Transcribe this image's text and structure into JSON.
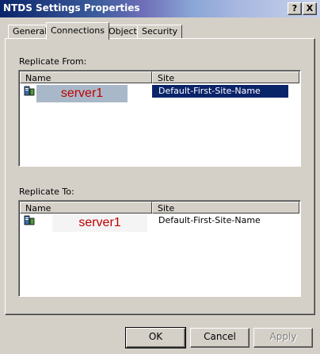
{
  "window": {
    "title": "NTDS Settings Properties"
  },
  "titlebar_buttons": {
    "help": "?",
    "close": "X"
  },
  "tabs": [
    {
      "label": "General",
      "active": false
    },
    {
      "label": "Connections",
      "active": true
    },
    {
      "label": "Object",
      "active": false
    },
    {
      "label": "Security",
      "active": false
    }
  ],
  "replicate_from": {
    "label": "Replicate From:",
    "columns": [
      "Name",
      "Site"
    ],
    "rows": [
      {
        "name": "server1",
        "site": "Default-First-Site-Name",
        "selected": true
      }
    ]
  },
  "replicate_to": {
    "label": "Replicate To:",
    "columns": [
      "Name",
      "Site"
    ],
    "rows": [
      {
        "name": "server1",
        "site": "Default-First-Site-Name",
        "selected": false
      }
    ]
  },
  "buttons": {
    "ok": "OK",
    "cancel": "Cancel",
    "apply": "Apply"
  },
  "colors": {
    "selection": "#0a246a",
    "name_text": "#c00000",
    "dialog_bg": "#d4d0c8"
  }
}
